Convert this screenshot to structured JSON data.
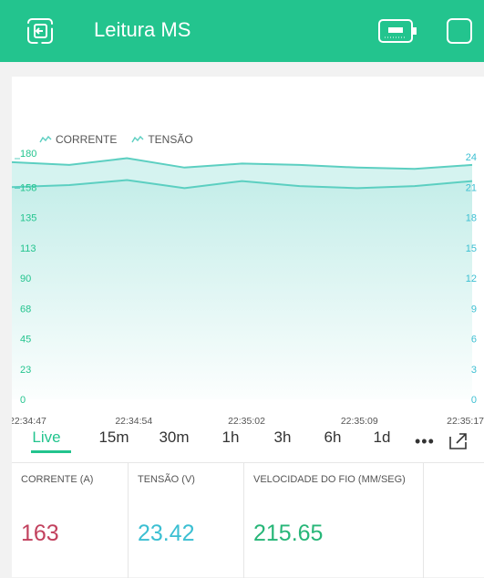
{
  "app": {
    "title": "Leitura MS"
  },
  "legend": {
    "items": [
      "CORRENTE",
      "TENSÃO"
    ]
  },
  "chart_data": {
    "type": "area",
    "x": [
      "22:34:47",
      "22:34:51",
      "22:34:54",
      "22:34:58",
      "22:35:02",
      "22:35:06",
      "22:35:09",
      "22:35:13",
      "22:35:17"
    ],
    "x_tick_labels": [
      "22:34:47",
      "22:34:54",
      "22:35:02",
      "22:35:09",
      "22:35:17"
    ],
    "left_axis": {
      "ticks": [
        "0",
        "23",
        "45",
        "68",
        "90",
        "113",
        "135",
        "158",
        "180"
      ],
      "ylim": [
        0,
        180
      ]
    },
    "right_axis": {
      "ticks": [
        "0",
        "3",
        "6",
        "9",
        "12",
        "15",
        "18",
        "21",
        "24"
      ],
      "ylim": [
        0,
        24
      ]
    },
    "series": [
      {
        "name": "CORRENTE",
        "axis": "left",
        "values": [
          176,
          174,
          179,
          172,
          175,
          174,
          172,
          171,
          174
        ]
      },
      {
        "name": "TENSÃO",
        "axis": "right",
        "values": [
          21.0,
          21.2,
          21.7,
          20.9,
          21.6,
          21.1,
          20.9,
          21.1,
          21.6
        ]
      }
    ],
    "colors": {
      "line": "#5ccfc1",
      "fill_top": "#bfece7"
    },
    "grid": false
  },
  "ranges": {
    "items": [
      "Live",
      "15m",
      "30m",
      "1h",
      "3h",
      "6h",
      "1d"
    ],
    "active": "Live",
    "more": "•••"
  },
  "values": [
    {
      "label": "CORRENTE (A)",
      "value": "163",
      "color": "#c2415e"
    },
    {
      "label": "TENSÃO (V)",
      "value": "23.42",
      "color": "#3bbfd2"
    },
    {
      "label": "VELOCIDADE DO FIO (MM/SEG)",
      "value": "215.65",
      "color": "#27b678"
    }
  ],
  "colors": {
    "header": "#23c48e",
    "accent": "#23c48e"
  },
  "icons": {
    "back": "exit-icon",
    "battery": "battery-icon",
    "menu": "square-icon",
    "expand": "expand-icon"
  }
}
